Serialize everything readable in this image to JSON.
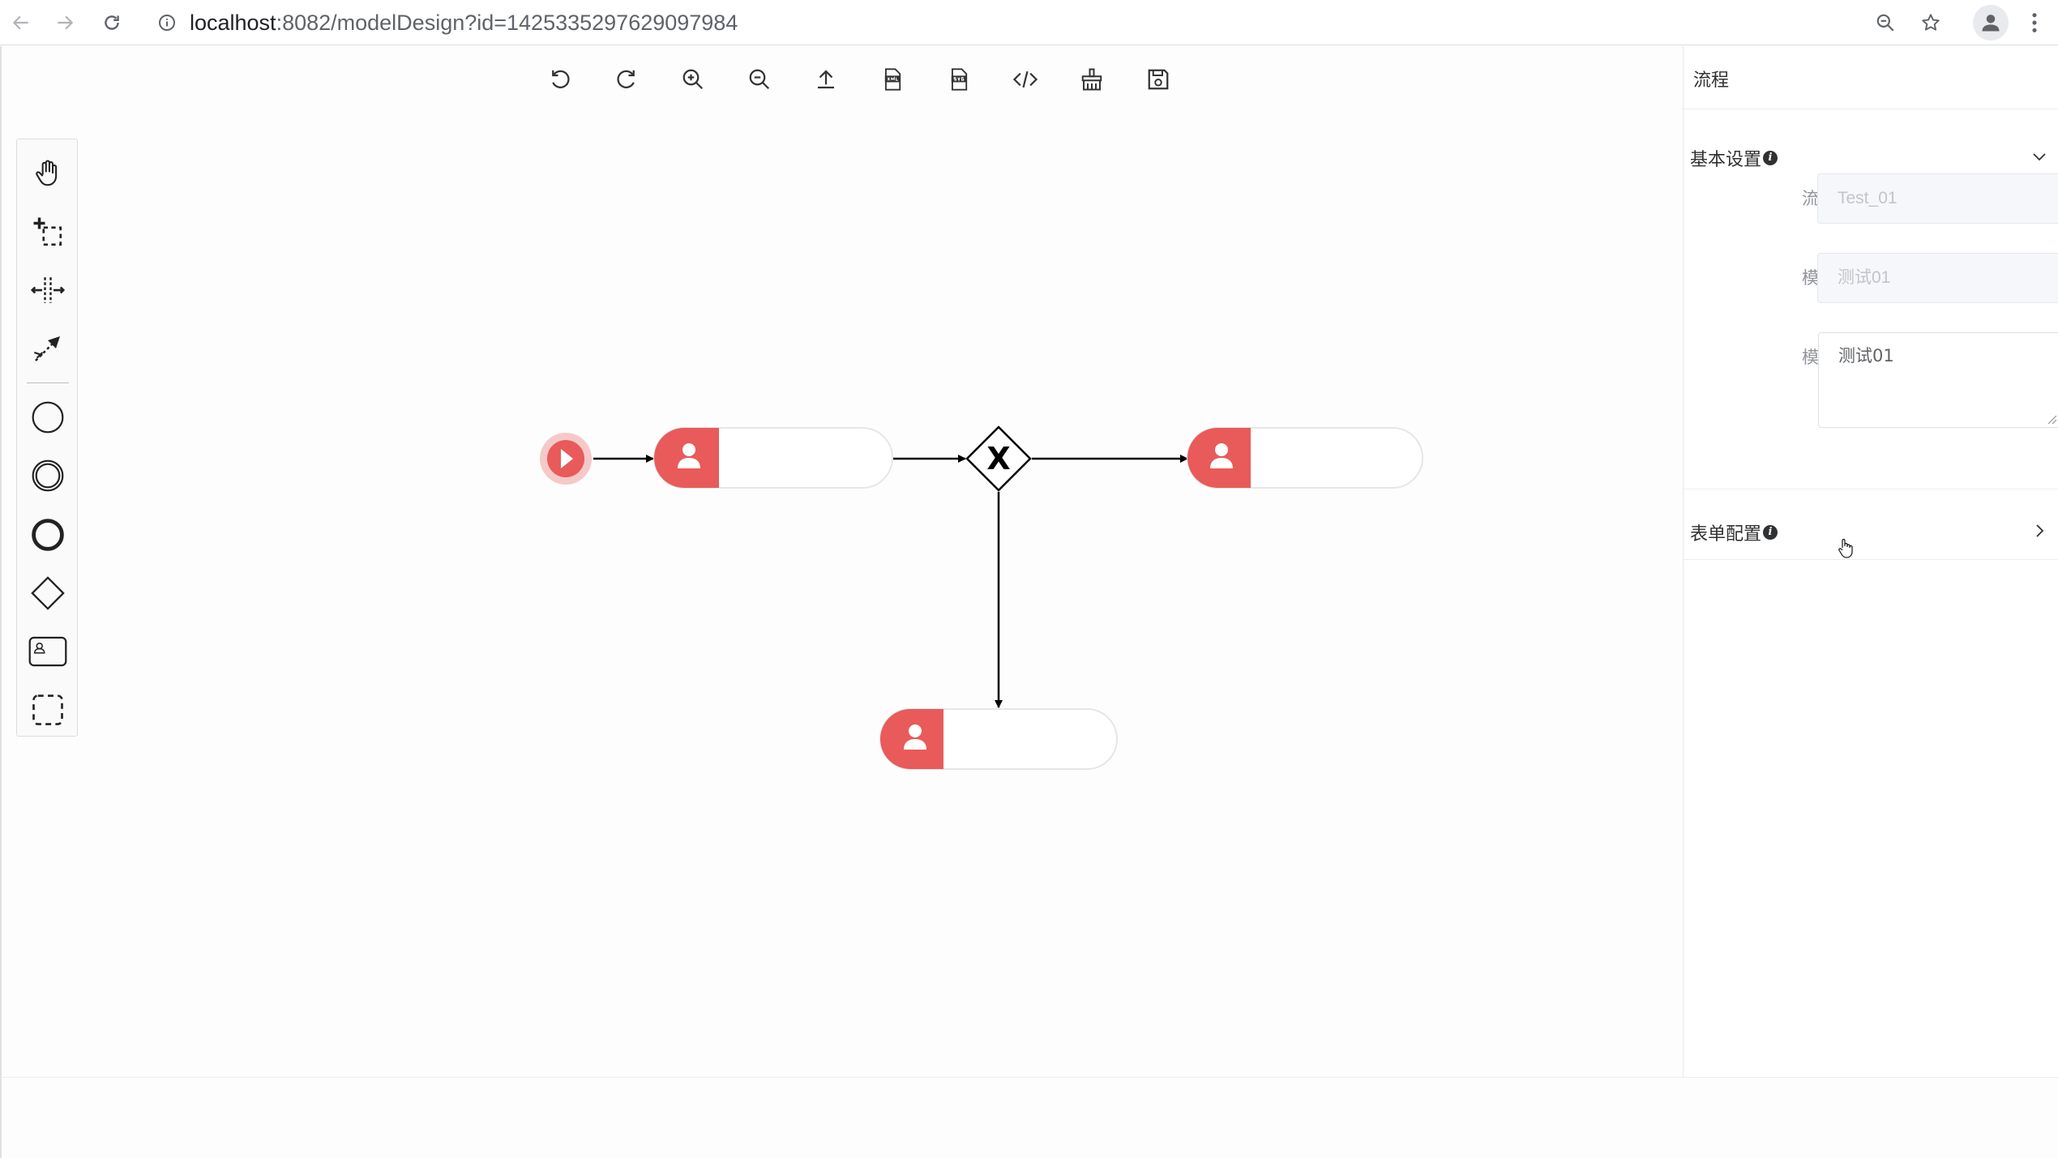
{
  "browser": {
    "url_host": "localhost",
    "url_rest": ":8082/modelDesign?id=1425335297629097984",
    "icons": [
      "back-arrow-icon",
      "forward-arrow-icon",
      "reload-icon",
      "info-icon",
      "zoom-icon",
      "star-icon",
      "profile-icon",
      "more-vert-icon"
    ]
  },
  "toolbar": {
    "buttons": [
      "undo-icon",
      "redo-icon",
      "zoom-in-icon",
      "zoom-out-icon",
      "import-icon",
      "download-xml-icon",
      "download-svg-icon",
      "xml-preview-icon",
      "clear-icon",
      "save-icon"
    ]
  },
  "palette": {
    "tools": [
      "hand-tool-icon",
      "lasso-tool-icon",
      "space-tool-icon",
      "connect-tool-icon"
    ],
    "shapes": [
      "start-event-icon",
      "intermediate-event-icon",
      "end-event-icon",
      "exclusive-gateway-icon",
      "user-task-icon",
      "group-icon"
    ]
  },
  "diagram": {
    "gateway_symbol": "X",
    "colors": {
      "task_head": "#e95a5a",
      "line": "#000000",
      "node_border": "#e0e0e0"
    }
  },
  "panel": {
    "title": "流程",
    "basic_settings": {
      "label": "基本设置",
      "info": "i",
      "fields": {
        "key_label": "流程主键",
        "key_value": "Test_01",
        "name_label": "模型名称",
        "name_value": "测试01",
        "desc_label": "模型描述",
        "desc_value": "测试01"
      }
    },
    "form_config": {
      "label": "表单配置",
      "info": "i"
    }
  }
}
